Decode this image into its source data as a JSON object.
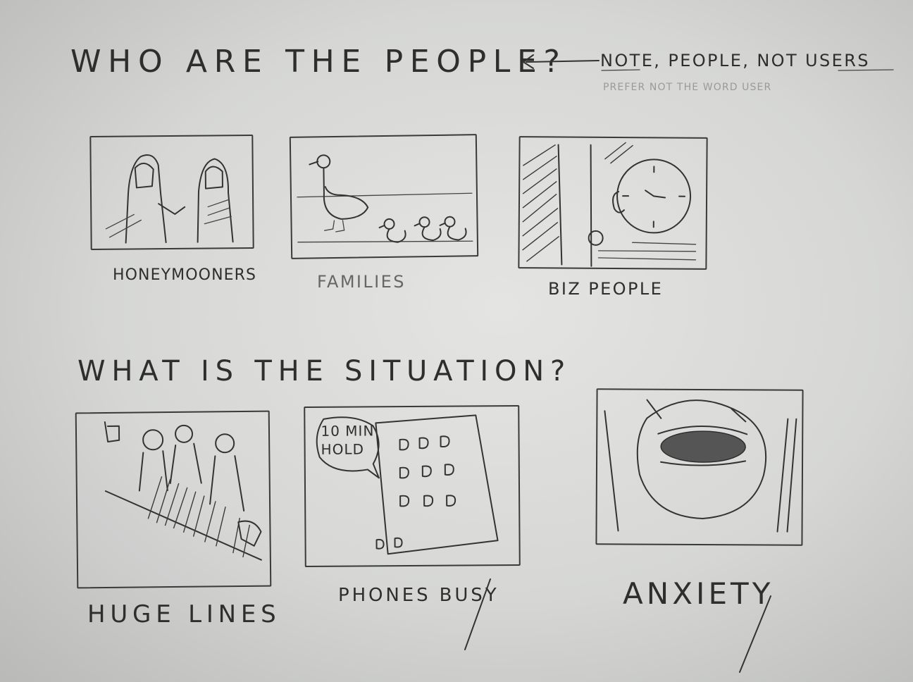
{
  "heading_people": "WHO ARE THE PEOPLE?",
  "note": {
    "arrow_text": "NOTE, PEOPLE, NOT USERS",
    "faint_line": "PREFER NOT THE WORD USER"
  },
  "people_panels": [
    {
      "label": "HONEYMOONERS",
      "icon": "couple-holding-hands"
    },
    {
      "label": "FAMILIES",
      "icon": "duck-with-ducklings"
    },
    {
      "label": "BIZ PEOPLE",
      "icon": "person-with-clock"
    }
  ],
  "heading_situation": "WHAT IS THE SITUATION?",
  "situation_panels": [
    {
      "label": "HUGE LINES",
      "icon": "queue-of-people"
    },
    {
      "label": "PHONES BUSY",
      "icon": "phone-keypad",
      "bubble": "10 MIN HOLD"
    },
    {
      "label": "ANXIETY",
      "icon": "stressed-face"
    }
  ]
}
